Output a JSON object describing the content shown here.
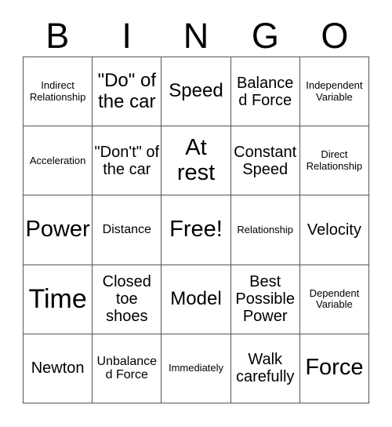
{
  "card": {
    "type": "bingo-card",
    "header_letters": [
      "B",
      "I",
      "N",
      "G",
      "O"
    ],
    "columns": 5,
    "rows": 5,
    "border_color": "#555555",
    "text_color": "#000000",
    "background_color": "#ffffff",
    "free_space_label": "Free!",
    "free_space_index": 12,
    "cells": [
      {
        "text": "Indirect Relationship",
        "size": "xs"
      },
      {
        "text": "\"Do\" of the car",
        "size": "l"
      },
      {
        "text": "Speed",
        "size": "l"
      },
      {
        "text": "Balanced Force",
        "size": "m"
      },
      {
        "text": "Independent Variable",
        "size": "xs"
      },
      {
        "text": "Acceleration",
        "size": "xs"
      },
      {
        "text": "\"Don't\" of the car",
        "size": "m"
      },
      {
        "text": "At rest",
        "size": "xl"
      },
      {
        "text": "Constant Speed",
        "size": "m"
      },
      {
        "text": "Direct Relationship",
        "size": "xs"
      },
      {
        "text": "Power",
        "size": "xl"
      },
      {
        "text": "Distance",
        "size": "s"
      },
      {
        "text": "Free!",
        "size": "xl"
      },
      {
        "text": "Relationship",
        "size": "xs"
      },
      {
        "text": "Velocity",
        "size": "m"
      },
      {
        "text": "Time",
        "size": "xxl"
      },
      {
        "text": "Closed toe shoes",
        "size": "m"
      },
      {
        "text": "Model",
        "size": "l"
      },
      {
        "text": "Best Possible Power",
        "size": "m"
      },
      {
        "text": "Dependent Variable",
        "size": "xs"
      },
      {
        "text": "Newton",
        "size": "m"
      },
      {
        "text": "Unbalanced Force",
        "size": "s"
      },
      {
        "text": "Immediately",
        "size": "xs"
      },
      {
        "text": "Walk carefully",
        "size": "m"
      },
      {
        "text": "Force",
        "size": "xl"
      }
    ]
  }
}
